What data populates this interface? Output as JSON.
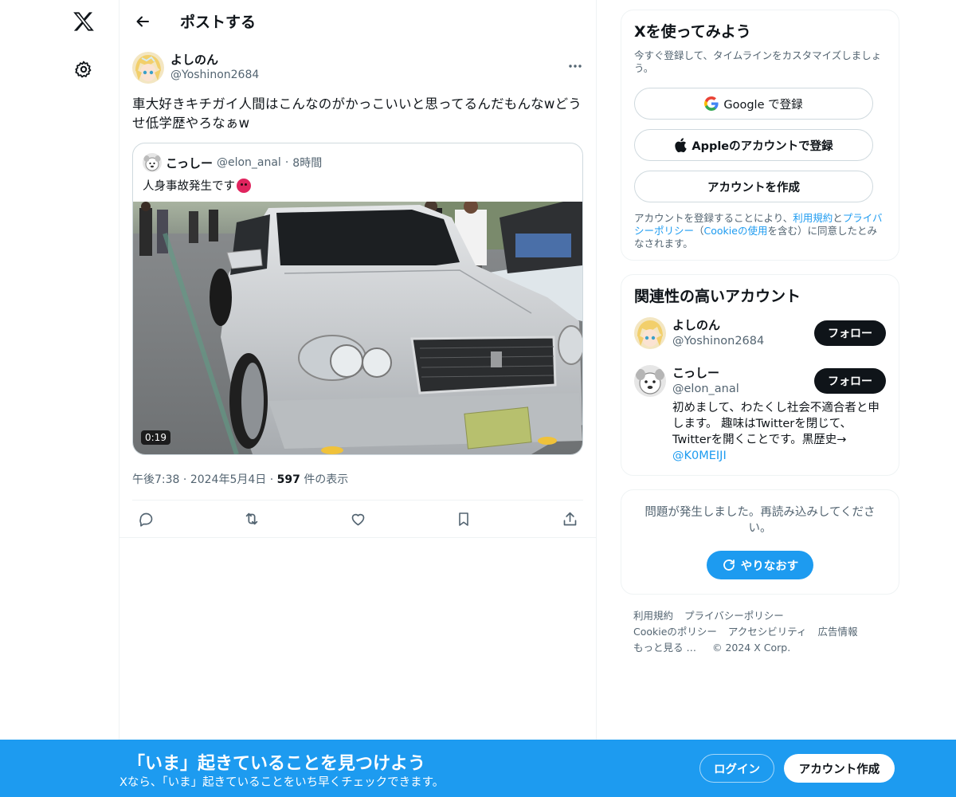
{
  "header": {
    "title": "ポストする"
  },
  "post": {
    "author": {
      "name": "よしのん",
      "handle": "@Yoshinon2684"
    },
    "text": "車大好きキチガイ人間はこんなのがかっこいいと思ってるんだもんなwどうせ低学歴やろなぁw",
    "quote": {
      "author": {
        "name": "こっしー",
        "handle": "@elon_anal",
        "separator": "·",
        "time": "8時間"
      },
      "text": "人身事故発生です",
      "video_duration": "0:19"
    },
    "meta": {
      "time": "午後7:38",
      "separator1": "·",
      "date": "2024年5月4日",
      "separator2": "·",
      "views": "597",
      "views_label": "件の表示"
    }
  },
  "signup": {
    "title": "Xを使ってみよう",
    "subtitle": "今すぐ登録して、タイムラインをカスタマイズしましょう。",
    "google": "Google で登録",
    "apple": "Appleのアカウントで登録",
    "create": "アカウントを作成",
    "legal_prefix": "アカウントを登録することにより、",
    "terms": "利用規約",
    "and": "と",
    "privacy": "プライバシーポリシー",
    "paren_open": "（",
    "cookie": "Cookieの使用",
    "legal_suffix": "を含む）に同意したとみなされます。"
  },
  "relevant": {
    "title": "関連性の高いアカウント",
    "accounts": [
      {
        "name": "よしのん",
        "handle": "@Yoshinon2684",
        "follow": "フォロー"
      },
      {
        "name": "こっしー",
        "handle": "@elon_anal",
        "follow": "フォロー",
        "bio": "初めまして、わたくし社会不適合者と申します。 趣味はTwitterを閉じて、Twitterを開くことです。黒歴史→",
        "bio_link": "@K0MEIJI"
      }
    ]
  },
  "error": {
    "message": "問題が発生しました。再読み込みしてください。",
    "retry": "やりなおす"
  },
  "footer": {
    "links": [
      "利用規約",
      "プライバシーポリシー",
      "Cookieのポリシー",
      "アクセシビリティ",
      "広告情報",
      "もっと見る …"
    ],
    "copyright": "© 2024 X Corp."
  },
  "banner": {
    "title": "「いま」起きていることを見つけよう",
    "subtitle": "Xなら、「いま」起きていることをいち早くチェックできます。",
    "login": "ログイン",
    "signup": "アカウント作成"
  },
  "colors": {
    "accent": "#1d9bf0",
    "text": "#0f1419",
    "secondary": "#536471",
    "border": "#eff3f4"
  }
}
